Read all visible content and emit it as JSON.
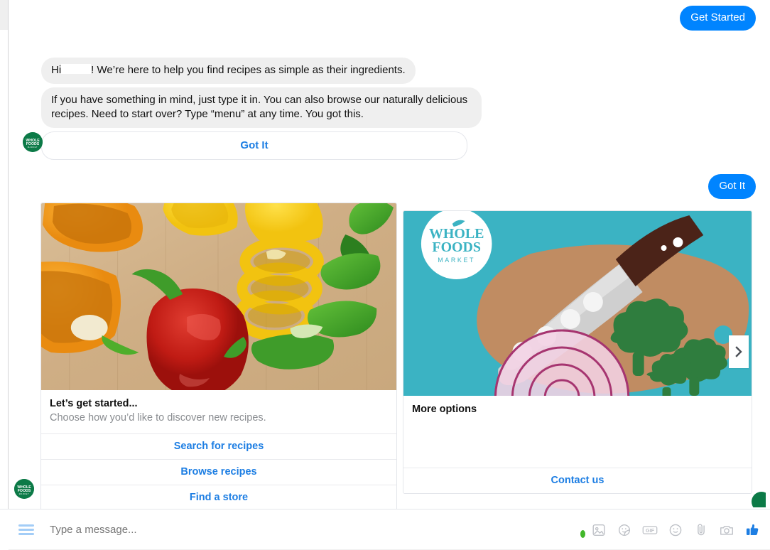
{
  "app": {
    "platform": "Facebook Messenger",
    "brand": "Whole Foods Market",
    "accent_blue": "#0084ff",
    "link_blue": "#1d7ee3",
    "bubble_grey": "#efefef",
    "brand_green": "#0c7a47",
    "brand_teal": "#3bb3c3"
  },
  "messages": {
    "get_started_label": "Get Started",
    "greeting_prefix": "Hi",
    "greeting_redacted": "",
    "greeting_suffix": "! We’re here to help you find recipes as simple as their ingredients.",
    "intro_text": "If you have something in mind, just type it in. You can also browse our naturally delicious recipes. Need to start over? Type “menu” at any time. You got this.",
    "got_it_button_label": "Got It",
    "got_it_reply_label": "Got It"
  },
  "carousel": {
    "next_arrow": "chevron-right-icon",
    "cards": [
      {
        "id": "lets-get-started",
        "hero": "bell-peppers-photo",
        "title": "Let’s get started...",
        "subtitle": "Choose how you’d like to discover new recipes.",
        "buttons": [
          "Search for recipes",
          "Browse recipes",
          "Find a store"
        ]
      },
      {
        "id": "more-options",
        "hero": "cutting-board-illustration",
        "title": "More options",
        "subtitle": "",
        "buttons": [
          "Contact us"
        ]
      }
    ]
  },
  "composer": {
    "menu_icon": "hamburger-menu-icon",
    "placeholder": "Type a message...",
    "icons": [
      "photo-icon",
      "sticker-icon",
      "gif-icon",
      "emoji-icon",
      "paperclip-icon",
      "camera-icon",
      "thumbs-up-icon"
    ]
  }
}
